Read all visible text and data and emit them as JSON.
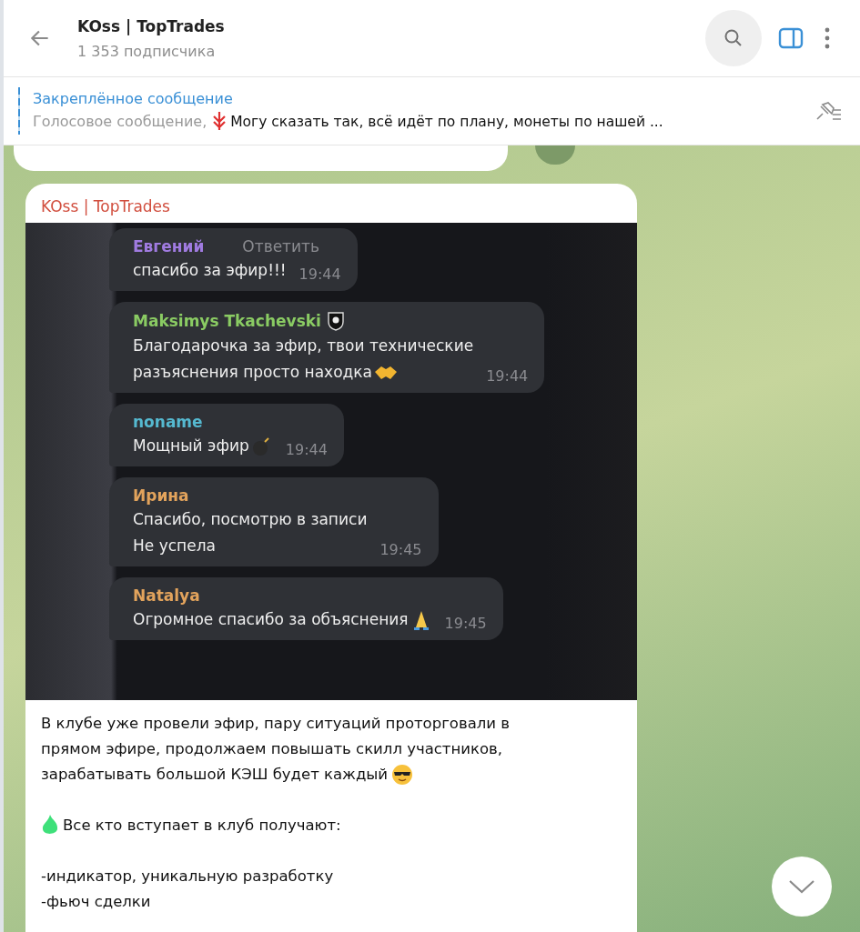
{
  "header": {
    "title": "KOss | TopTrades",
    "subtitle": "1 353 подписчика"
  },
  "pinned": {
    "title": "Закреплённое сообщение",
    "media_label": "Голосовое сообщение,",
    "text": "Могу сказать так, всё идёт по плану, монеты по нашей ..."
  },
  "post": {
    "author": "KOss | TopTrades",
    "screenshot_messages": [
      {
        "name": "Евгений",
        "color": "#a07be0",
        "lines": [
          "спасибо за эфир!!!"
        ],
        "time": "19:44",
        "reply": "Ответить"
      },
      {
        "name": "Maksimys Tkachevski",
        "color": "#8acb63",
        "lines": [
          "Благодарочка за эфир, твои технические",
          "разъяснения просто находка"
        ],
        "time": "19:44"
      },
      {
        "name": "noname",
        "color": "#55b9d0",
        "lines": [
          "Мощный эфир"
        ],
        "time": "19:44"
      },
      {
        "name": "Ирина",
        "color": "#e2a35c",
        "lines": [
          "Спасибо, посмотрю в записи",
          "Не успела"
        ],
        "time": "19:45"
      },
      {
        "name": "Natalya",
        "color": "#e2a35c",
        "lines": [
          "Огромное спасибо за объяснения"
        ],
        "time": "19:45"
      }
    ],
    "paragraphs": [
      [
        "В клубе уже провели эфир, пару ситуаций проторговали в",
        "прямом эфире, продолжаем повышать скилл участников,",
        "зарабатывать большой КЭШ будет каждый"
      ],
      [
        "Все кто вступает в клуб получают:"
      ],
      [
        "-индикатор, уникальную разработку",
        "-фьюч сделки"
      ]
    ]
  }
}
